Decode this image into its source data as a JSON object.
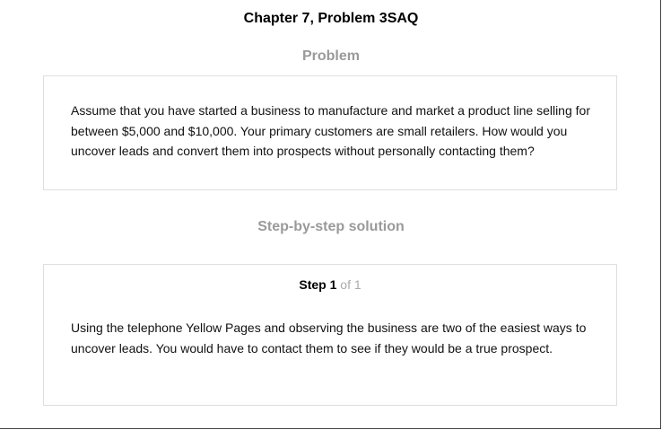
{
  "title": "Chapter 7, Problem 3SAQ",
  "problem": {
    "heading": "Problem",
    "text": "Assume that you have started a business to manufacture and market a product line selling for between $5,000 and $10,000. Your primary customers are small retailers. How would you uncover leads and convert them into prospects without personally contacting them?"
  },
  "solution": {
    "heading": "Step-by-step solution",
    "step_label": "Step",
    "step_number": "1",
    "step_of": "of 1",
    "text": "Using the telephone Yellow Pages and observing the business are two of the easiest ways to uncover leads. You would have to contact them to see if they would be a true prospect."
  }
}
